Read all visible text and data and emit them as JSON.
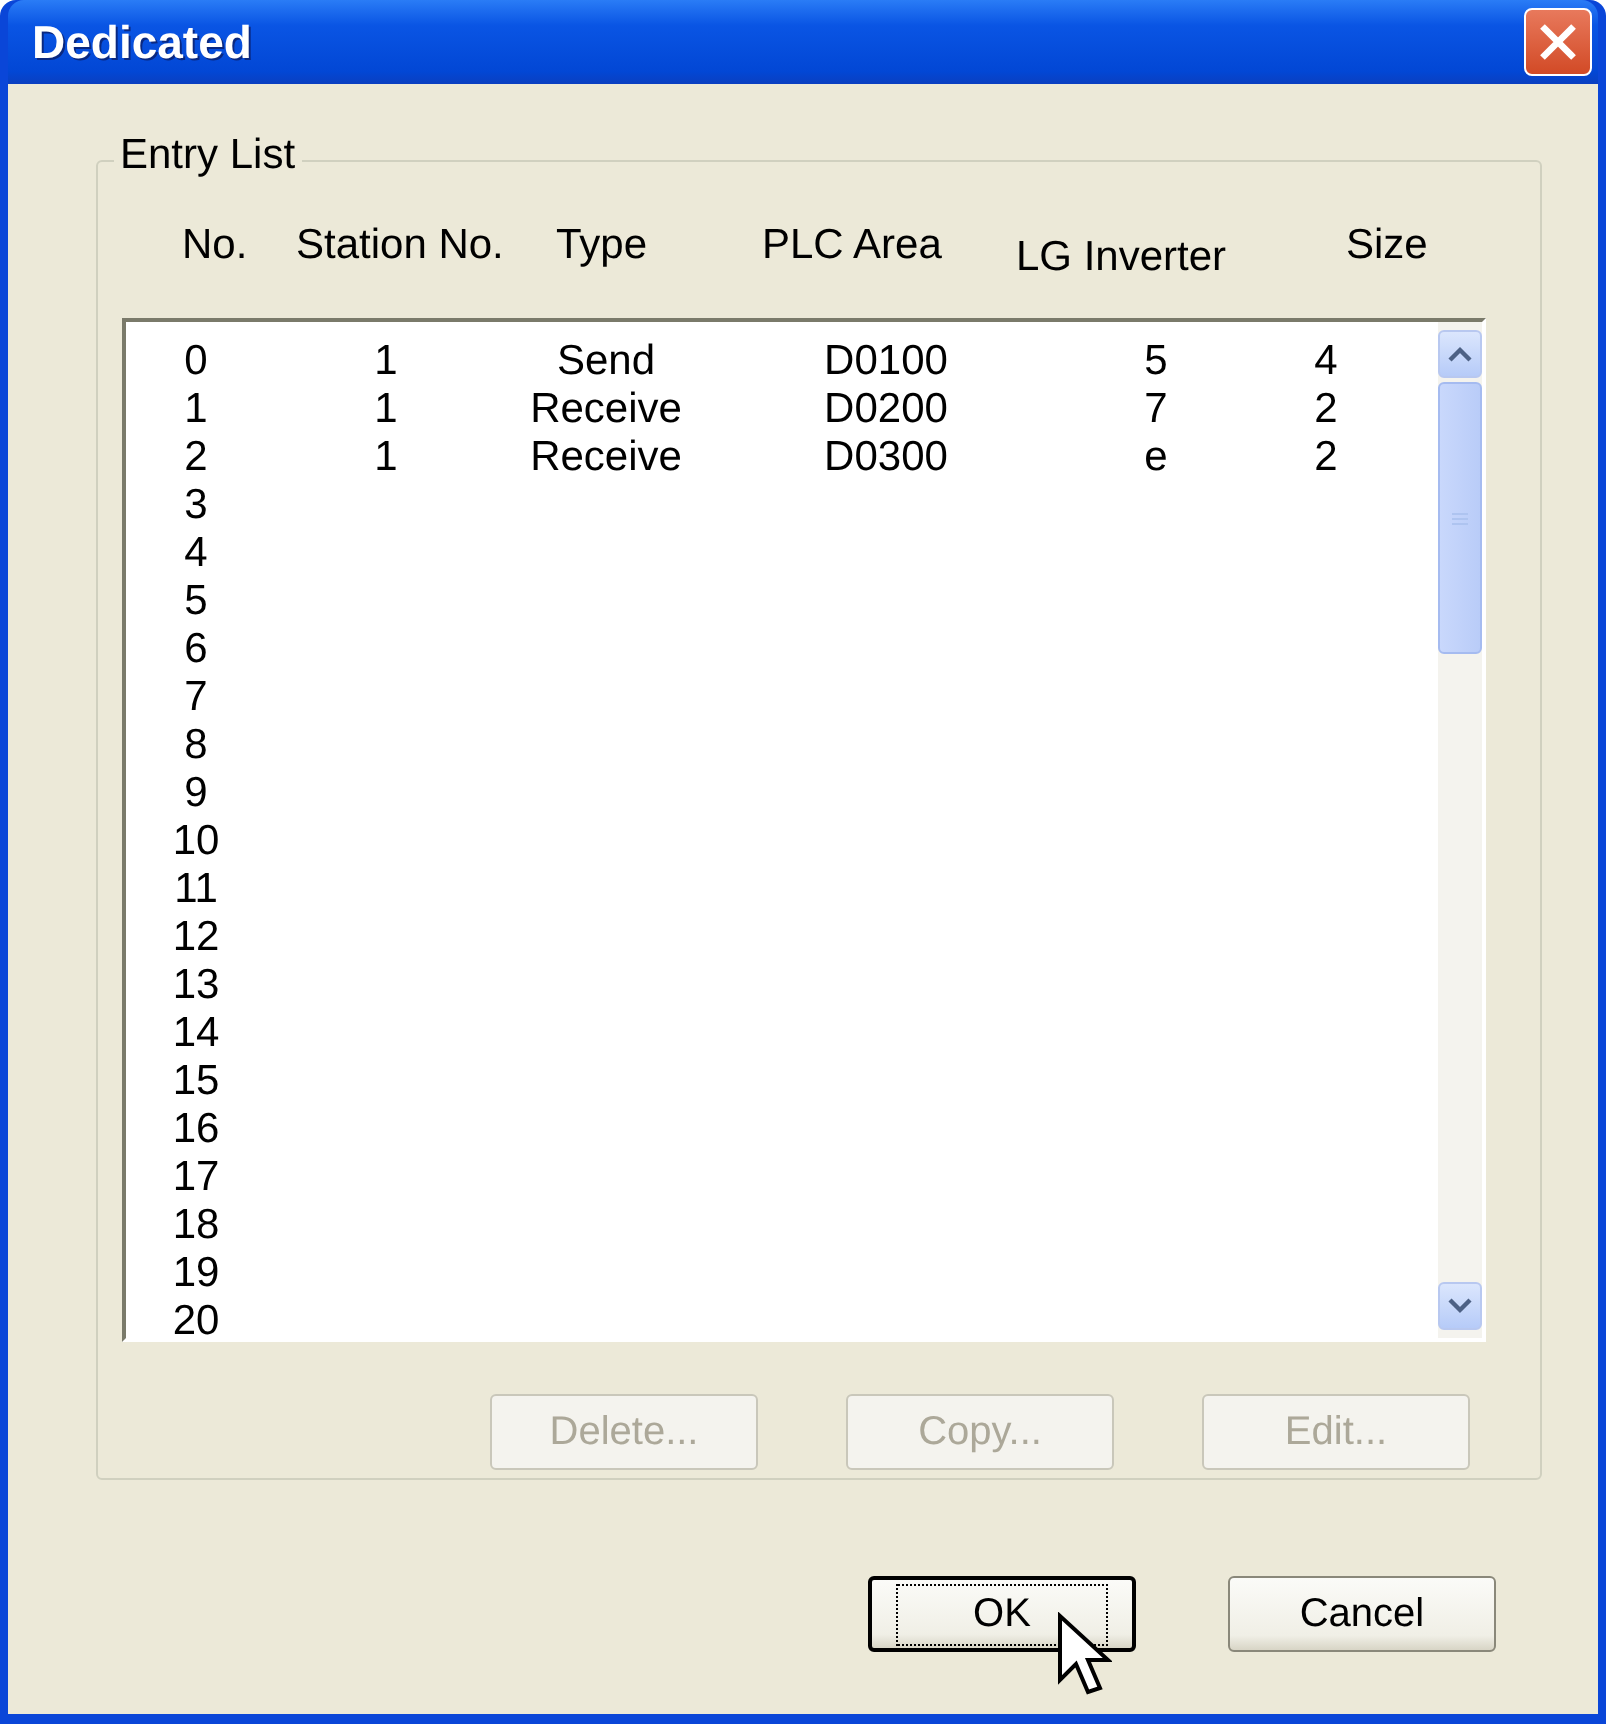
{
  "window": {
    "title": "Dedicated"
  },
  "group": {
    "label": "Entry List"
  },
  "columns": [
    "No.",
    "Station No.",
    "Type",
    "PLC Area",
    "LG Inverter",
    "Size"
  ],
  "rows": [
    {
      "no": "0",
      "station": "1",
      "type": "Send",
      "plc_area": "D0100",
      "inverter": "5",
      "size": "4"
    },
    {
      "no": "1",
      "station": "1",
      "type": "Receive",
      "plc_area": "D0200",
      "inverter": "7",
      "size": "2"
    },
    {
      "no": "2",
      "station": "1",
      "type": "Receive",
      "plc_area": "D0300",
      "inverter": "e",
      "size": "2"
    },
    {
      "no": "3"
    },
    {
      "no": "4"
    },
    {
      "no": "5"
    },
    {
      "no": "6"
    },
    {
      "no": "7"
    },
    {
      "no": "8"
    },
    {
      "no": "9"
    },
    {
      "no": "10"
    },
    {
      "no": "11"
    },
    {
      "no": "12"
    },
    {
      "no": "13"
    },
    {
      "no": "14"
    },
    {
      "no": "15"
    },
    {
      "no": "16"
    },
    {
      "no": "17"
    },
    {
      "no": "18"
    },
    {
      "no": "19"
    },
    {
      "no": "20"
    }
  ],
  "list_buttons": [
    {
      "label": "Delete...",
      "disabled": true
    },
    {
      "label": "Copy...",
      "disabled": true
    },
    {
      "label": "Edit...",
      "disabled": true
    }
  ],
  "dialog_buttons": [
    {
      "label": "OK",
      "default": true
    },
    {
      "label": "Cancel",
      "default": false
    }
  ]
}
